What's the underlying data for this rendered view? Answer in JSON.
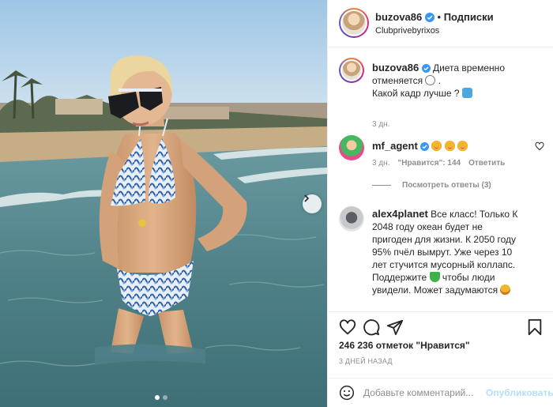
{
  "post": {
    "author": "buzova86",
    "follow_label": "Подписки",
    "location": "Clubprivebyrixos",
    "more_icon": "more-horizontal-icon",
    "caption": {
      "username": "buzova86",
      "line1": "Диета временно",
      "line2": "отменяется",
      "line3": "Какой кадр лучше ?",
      "time": "3 дн."
    },
    "comments": [
      {
        "username": "mf_agent",
        "verified": true,
        "text": "",
        "emoji": [
          "heart-eyes",
          "heart-eyes",
          "heart-eyes"
        ],
        "time": "3 дн.",
        "likes": "\"Нравится\": 144",
        "reply": "Ответить",
        "view_replies": "Посмотреть ответы (3)"
      },
      {
        "username": "alex4planet",
        "verified": false,
        "text": "Все класс! Только К 2048 году океан будет не пригоден для жизни. К 2050 году 95% пчёл вымрут. Уже через 10 лет стучится мусорный коллапс. Поддержите",
        "text_tail": "чтобы люди увидели. Может задумаются"
      }
    ],
    "likes_text": "246 236 отметок \"Нравится\"",
    "date_text": "3 ДНЕЙ НАЗАД",
    "comment_placeholder": "Добавьте комментарий...",
    "publish_label": "Опубликовать",
    "carousel": {
      "total": 2,
      "active": 1
    },
    "colors": {
      "verified_blue": "#3897f0",
      "muted": "#8e8e8e",
      "publish_disabled": "#b2dffc",
      "text": "#262626"
    },
    "icons": [
      "heart-icon",
      "comment-icon",
      "share-icon",
      "bookmark-icon",
      "smile-icon",
      "chevron-right-icon",
      "verified-icon"
    ]
  }
}
